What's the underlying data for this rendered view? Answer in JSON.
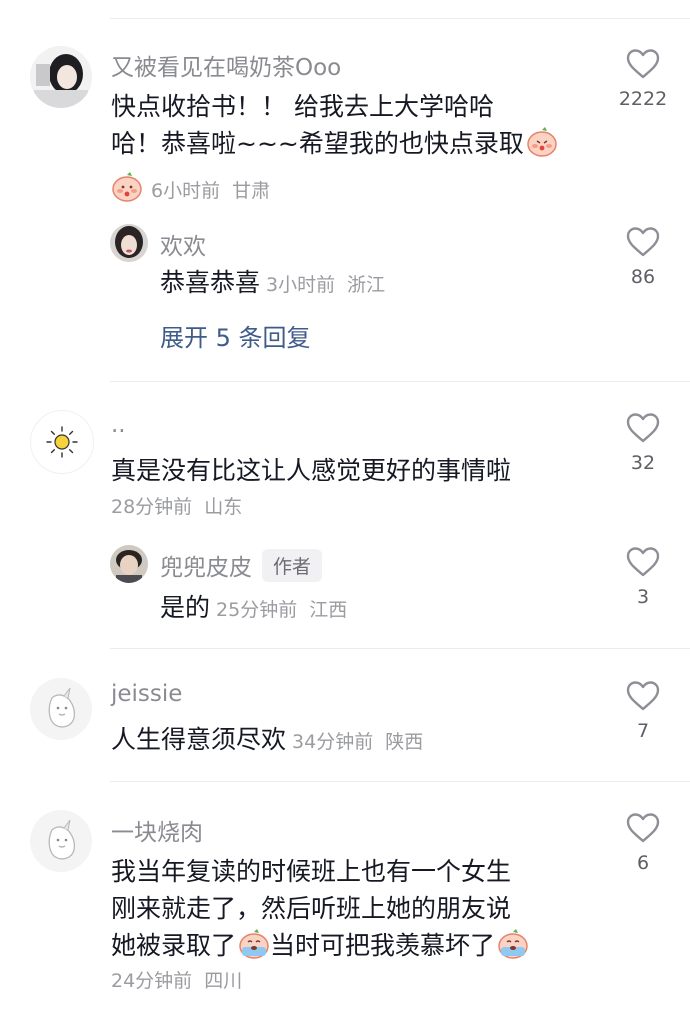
{
  "comments": [
    {
      "name": "又被看见在喝奶茶Ooo",
      "text_a": "快点收拾书！！ 给我去上大学哈哈",
      "text_b": "哈！恭喜啦~~~希望我的也快点录取",
      "time": "6小时前",
      "location": "甘肃",
      "likes": "2222",
      "emoji": "peach-face-emoji"
    },
    {
      "name": "..",
      "text": "真是没有比这让人感觉更好的事情啦",
      "time": "28分钟前",
      "location": "山东",
      "likes": "32"
    },
    {
      "name": "jeissie",
      "text": "人生得意须尽欢",
      "time": "34分钟前",
      "location": "陕西",
      "likes": "7"
    },
    {
      "name": "一块烧肉",
      "text_a": "我当年复读的时候班上也有一个女生",
      "text_b": "刚来就走了，然后听班上她的朋友说",
      "text_c1": "她被录取了",
      "text_c2": "当时可把我羡慕坏了",
      "time": "24分钟前",
      "location": "四川",
      "likes": "6",
      "emoji": "crying-peach-emoji"
    }
  ],
  "replies": [
    {
      "name": "欢欢",
      "text": "恭喜恭喜",
      "time": "3小时前",
      "location": "浙江",
      "likes": "86"
    },
    {
      "name": "兜兜皮皮",
      "badge": "作者",
      "text": "是的",
      "time": "25分钟前",
      "location": "江西",
      "likes": "3"
    }
  ],
  "expand_replies": "展开 5 条回复",
  "colors": {
    "name": "#8a8b91",
    "meta": "#9b9ca1",
    "link": "#3e5b8a",
    "heart": "#8e8f96"
  }
}
